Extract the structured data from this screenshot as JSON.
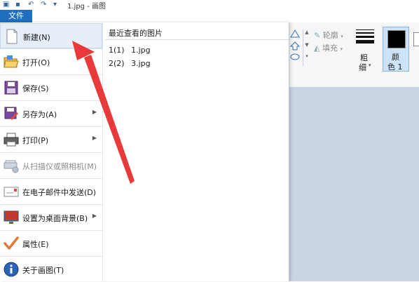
{
  "window": {
    "title": "1.jpg - 画图"
  },
  "file_tab": {
    "label": "文件"
  },
  "file_menu": {
    "items": [
      {
        "label": "新建(N)",
        "icon": "new-file-icon",
        "selected": true,
        "disabled": false,
        "submenu": false
      },
      {
        "label": "打开(O)",
        "icon": "open-folder-icon",
        "selected": false,
        "disabled": false,
        "submenu": false
      },
      {
        "label": "保存(S)",
        "icon": "save-icon",
        "selected": false,
        "disabled": false,
        "submenu": false
      },
      {
        "label": "另存为(A)",
        "icon": "save-as-icon",
        "selected": false,
        "disabled": false,
        "submenu": true
      },
      {
        "label": "打印(P)",
        "icon": "printer-icon",
        "selected": false,
        "disabled": false,
        "submenu": true
      },
      {
        "label": "从扫描仪或照相机(M)",
        "icon": "scanner-icon",
        "selected": false,
        "disabled": true,
        "submenu": false
      },
      {
        "label": "在电子邮件中发送(D)",
        "icon": "email-icon",
        "selected": false,
        "disabled": false,
        "submenu": false
      },
      {
        "label": "设置为桌面背景(B)",
        "icon": "desktop-icon",
        "selected": false,
        "disabled": false,
        "submenu": true
      },
      {
        "label": "属性(E)",
        "icon": "checkmark-icon",
        "selected": false,
        "disabled": false,
        "submenu": false
      },
      {
        "label": "关于画图(T)",
        "icon": "info-icon",
        "selected": false,
        "disabled": false,
        "submenu": false
      }
    ],
    "recent_title": "最近查看的图片",
    "recent": [
      {
        "index": "1(1)",
        "name": "1.jpg"
      },
      {
        "index": "2(2)",
        "name": "3.jpg"
      }
    ]
  },
  "ribbon": {
    "outline_label": "轮廓",
    "fill_label": "填充",
    "size_label_1": "粗",
    "size_label_2": "细",
    "color1_label_1": "颜",
    "color1_label_2": "色 1"
  },
  "colors": {
    "accent": "#1f6fbf",
    "annotation_arrow": "#e8393b",
    "canvas_bg": "#c9d3e1"
  }
}
